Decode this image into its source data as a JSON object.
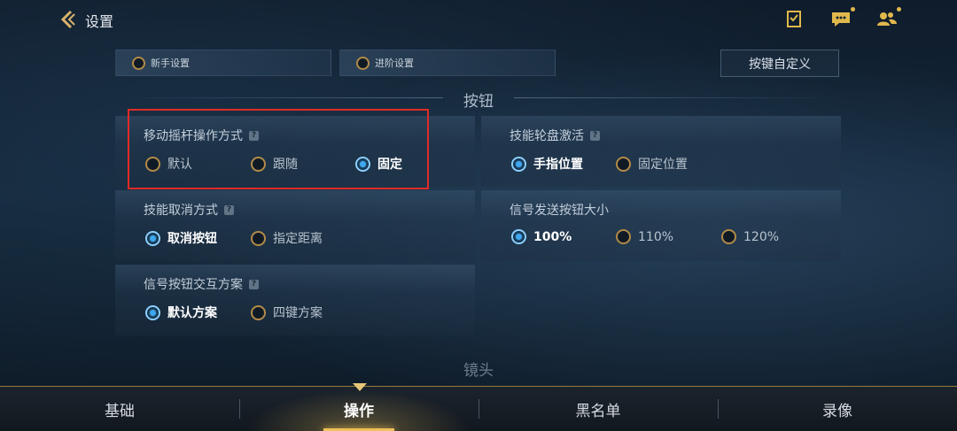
{
  "header": {
    "title": "设置"
  },
  "top_icons": [
    "task-icon",
    "chat-icon",
    "friends-icon"
  ],
  "mode_tabs": [
    {
      "label": "新手设置",
      "selected": false
    },
    {
      "label": "进阶设置",
      "selected": false
    }
  ],
  "customize_button": "按键自定义",
  "section": {
    "title": "按钮"
  },
  "panels": {
    "joystick": {
      "title": "移动摇杆操作方式",
      "options": [
        "默认",
        "跟随",
        "固定"
      ],
      "selected": "固定"
    },
    "skill_wheel": {
      "title": "技能轮盘激活",
      "options": [
        "手指位置",
        "固定位置"
      ],
      "selected": "手指位置"
    },
    "skill_cancel": {
      "title": "技能取消方式",
      "options": [
        "取消按钮",
        "指定距离"
      ],
      "selected": "取消按钮"
    },
    "signal_size": {
      "title": "信号发送按钮大小",
      "options": [
        "100%",
        "110%",
        "120%"
      ],
      "selected": "100%"
    },
    "signal_scheme": {
      "title": "信号按钮交互方案",
      "options": [
        "默认方案",
        "四键方案"
      ],
      "selected": "默认方案"
    }
  },
  "next_section": {
    "title": "镜头"
  },
  "bottom_tabs": [
    "基础",
    "操作",
    "黑名单",
    "录像"
  ],
  "active_bottom_tab": "操作",
  "colors": {
    "highlight": "#e02b27",
    "accent_gold": "#f0c15a",
    "radio_selected": "#3fa7ef"
  }
}
